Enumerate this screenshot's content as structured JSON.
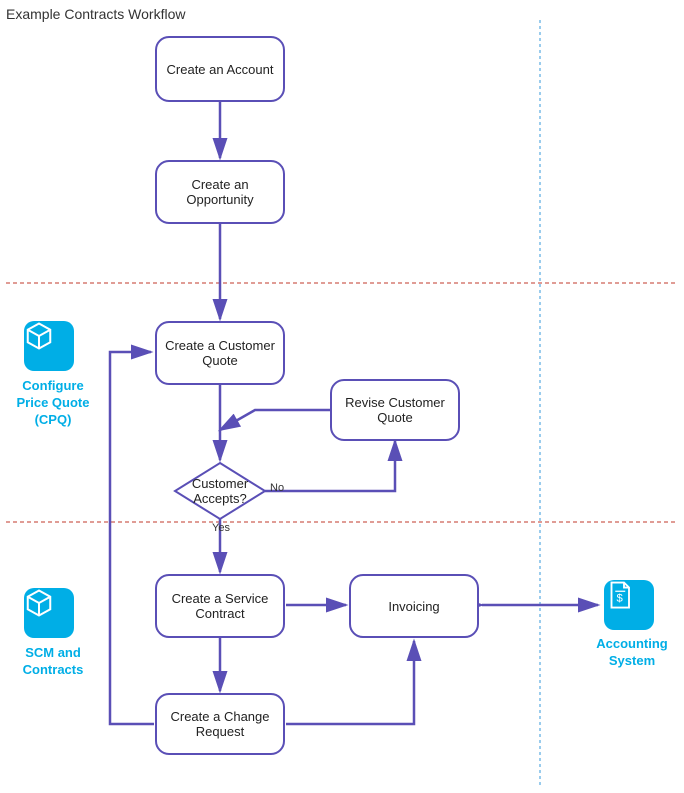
{
  "title": "Example Contracts Workflow",
  "nodes": {
    "account": "Create an Account",
    "opportunity": "Create an Opportunity",
    "quote": "Create a Customer Quote",
    "revise": "Revise Customer Quote",
    "decision": "Customer Accepts?",
    "service": "Create a Service Contract",
    "invoicing": "Invoicing",
    "change": "Create a Change Request"
  },
  "edge_labels": {
    "yes": "Yes",
    "no": "No"
  },
  "sections": {
    "cpq": "Configure Price Quote (CPQ)",
    "scm": "SCM and Contracts",
    "accounting": "Accounting System"
  },
  "colors": {
    "stroke": "#5a4fb6",
    "accent": "#00aee6",
    "dashRed": "#c0392b",
    "dashBlue": "#3498db"
  }
}
